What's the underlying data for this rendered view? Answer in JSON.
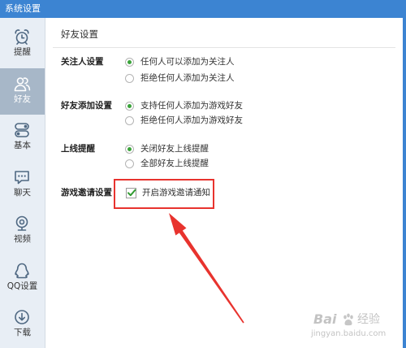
{
  "window": {
    "title": "系统设置"
  },
  "sidebar": {
    "items": [
      {
        "label": "提醒",
        "icon": "alarm-clock-icon",
        "selected": false
      },
      {
        "label": "好友",
        "icon": "friends-icon",
        "selected": true
      },
      {
        "label": "基本",
        "icon": "toggle-switch-icon",
        "selected": false
      },
      {
        "label": "聊天",
        "icon": "chat-bubble-icon",
        "selected": false
      },
      {
        "label": "视频",
        "icon": "webcam-icon",
        "selected": false
      },
      {
        "label": "QQ设置",
        "icon": "qq-penguin-icon",
        "selected": false
      },
      {
        "label": "下载",
        "icon": "download-icon",
        "selected": false
      }
    ]
  },
  "main": {
    "title": "好友设置",
    "sections": [
      {
        "label": "关注人设置",
        "options": [
          {
            "label": "任何人可以添加为关注人",
            "checked": true
          },
          {
            "label": "拒绝任何人添加为关注人",
            "checked": false
          }
        ]
      },
      {
        "label": "好友添加设置",
        "options": [
          {
            "label": "支持任何人添加为游戏好友",
            "checked": true
          },
          {
            "label": "拒绝任何人添加为游戏好友",
            "checked": false
          }
        ]
      },
      {
        "label": "上线提醒",
        "options": [
          {
            "label": "关闭好友上线提醒",
            "checked": true
          },
          {
            "label": "全部好友上线提醒",
            "checked": false
          }
        ]
      },
      {
        "label": "游戏邀请设置",
        "options": [
          {
            "label": "开启游戏邀请通知",
            "checked": true
          }
        ]
      }
    ]
  },
  "watermark": {
    "brand_latin": "Bai",
    "brand_cn": "经验",
    "url": "jingyan.baidu.com"
  },
  "colors": {
    "title_bar": "#3c84d2",
    "sidebar_bg": "#e8eef5",
    "sidebar_selected": "#a7b7c8",
    "icon": "#4f6882",
    "radio_checked": "#3aa33a",
    "annotation_red": "#e8332e"
  }
}
